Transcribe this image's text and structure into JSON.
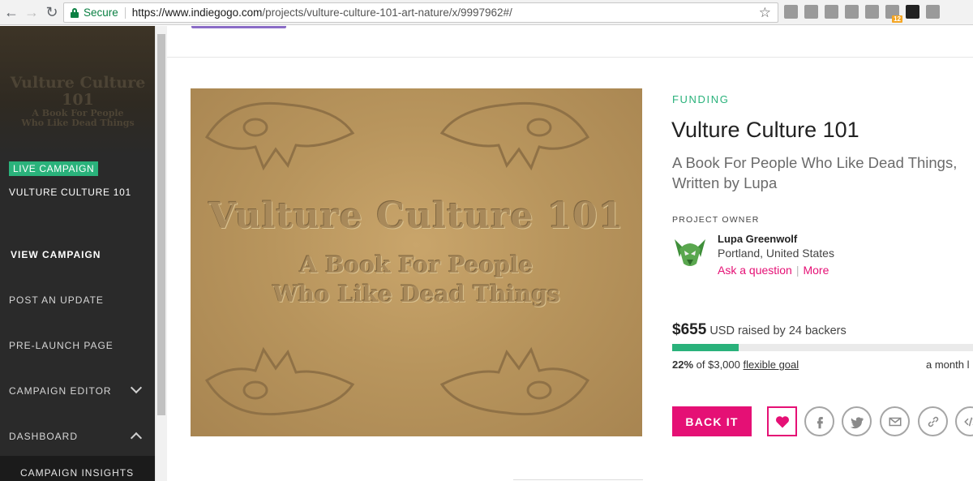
{
  "browser": {
    "secure_label": "Secure",
    "url_prefix": "https://",
    "url_host": "www.indiegogo.com",
    "url_path": "/projects/vulture-culture-101-art-nature/x/9997962#/",
    "extension_badge": "12"
  },
  "sidebar": {
    "hero_title": "Vulture Culture 101",
    "hero_subtitle_1": "A Book For People",
    "hero_subtitle_2": "Who Like Dead Things",
    "status_badge": "LIVE CAMPAIGN",
    "campaign_title": "VULTURE CULTURE 101",
    "items": [
      {
        "label": "VIEW CAMPAIGN"
      },
      {
        "label": "POST AN UPDATE"
      },
      {
        "label": "PRE-LAUNCH PAGE"
      },
      {
        "label": "CAMPAIGN EDITOR"
      },
      {
        "label": "DASHBOARD"
      }
    ],
    "sub_item": "CAMPAIGN INSIGHTS"
  },
  "hero_image": {
    "title": "Vulture Culture 101",
    "subtitle_1": "A Book For People",
    "subtitle_2": "Who Like Dead Things"
  },
  "campaign": {
    "status": "FUNDING",
    "title": "Vulture Culture 101",
    "tagline": "A Book For People Who Like Dead Things, Written by Lupa",
    "owner_label": "PROJECT OWNER",
    "owner_name": "Lupa Greenwolf",
    "owner_location": "Portland, United States",
    "ask_link": "Ask a question",
    "more_link": "More",
    "raised_amount": "$655",
    "raised_text": "USD raised by 24 backers",
    "percent": "22%",
    "percent_value": 22,
    "goal_text": "of $3,000",
    "goal_type": "flexible goal",
    "time_left": "a month l",
    "back_label": "BACK IT"
  },
  "colors": {
    "accent_pink": "#e51075",
    "accent_green": "#2ab27b"
  }
}
